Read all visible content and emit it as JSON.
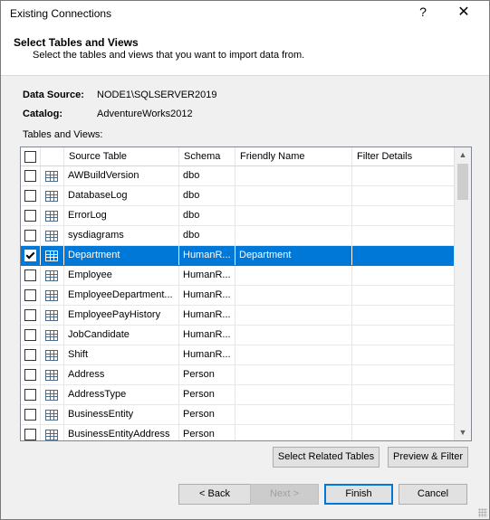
{
  "window": {
    "title": "Existing Connections",
    "help": "?",
    "close": "✕"
  },
  "header": {
    "title": "Select Tables and Views",
    "subtitle": "Select the tables and views that you want to import data from."
  },
  "info": {
    "data_source_label": "Data Source:",
    "data_source_value": "NODE1\\SQLSERVER2019",
    "catalog_label": "Catalog:",
    "catalog_value": "AdventureWorks2012"
  },
  "tables_label": "Tables and Views:",
  "grid": {
    "columns": [
      "Source Table",
      "Schema",
      "Friendly Name",
      "Filter Details"
    ],
    "rows": [
      {
        "source": "AWBuildVersion",
        "schema": "dbo",
        "friendly": "",
        "filter": "",
        "checked": false
      },
      {
        "source": "DatabaseLog",
        "schema": "dbo",
        "friendly": "",
        "filter": "",
        "checked": false
      },
      {
        "source": "ErrorLog",
        "schema": "dbo",
        "friendly": "",
        "filter": "",
        "checked": false
      },
      {
        "source": "sysdiagrams",
        "schema": "dbo",
        "friendly": "",
        "filter": "",
        "checked": false
      },
      {
        "source": "Department",
        "schema": "HumanR...",
        "friendly": "Department",
        "filter": "",
        "checked": true
      },
      {
        "source": "Employee",
        "schema": "HumanR...",
        "friendly": "",
        "filter": "",
        "checked": false
      },
      {
        "source": "EmployeeDepartment...",
        "schema": "HumanR...",
        "friendly": "",
        "filter": "",
        "checked": false
      },
      {
        "source": "EmployeePayHistory",
        "schema": "HumanR...",
        "friendly": "",
        "filter": "",
        "checked": false
      },
      {
        "source": "JobCandidate",
        "schema": "HumanR...",
        "friendly": "",
        "filter": "",
        "checked": false
      },
      {
        "source": "Shift",
        "schema": "HumanR...",
        "friendly": "",
        "filter": "",
        "checked": false
      },
      {
        "source": "Address",
        "schema": "Person",
        "friendly": "",
        "filter": "",
        "checked": false
      },
      {
        "source": "AddressType",
        "schema": "Person",
        "friendly": "",
        "filter": "",
        "checked": false
      },
      {
        "source": "BusinessEntity",
        "schema": "Person",
        "friendly": "",
        "filter": "",
        "checked": false
      },
      {
        "source": "BusinessEntityAddress",
        "schema": "Person",
        "friendly": "",
        "filter": "",
        "checked": false
      }
    ],
    "selected_index": 4
  },
  "buttons": {
    "select_related": "Select Related Tables",
    "preview_filter": "Preview & Filter",
    "back": "< Back",
    "next": "Next >",
    "finish": "Finish",
    "cancel": "Cancel"
  },
  "colors": {
    "selection": "#0078d7",
    "dialog_bg": "#f0f0f0"
  }
}
